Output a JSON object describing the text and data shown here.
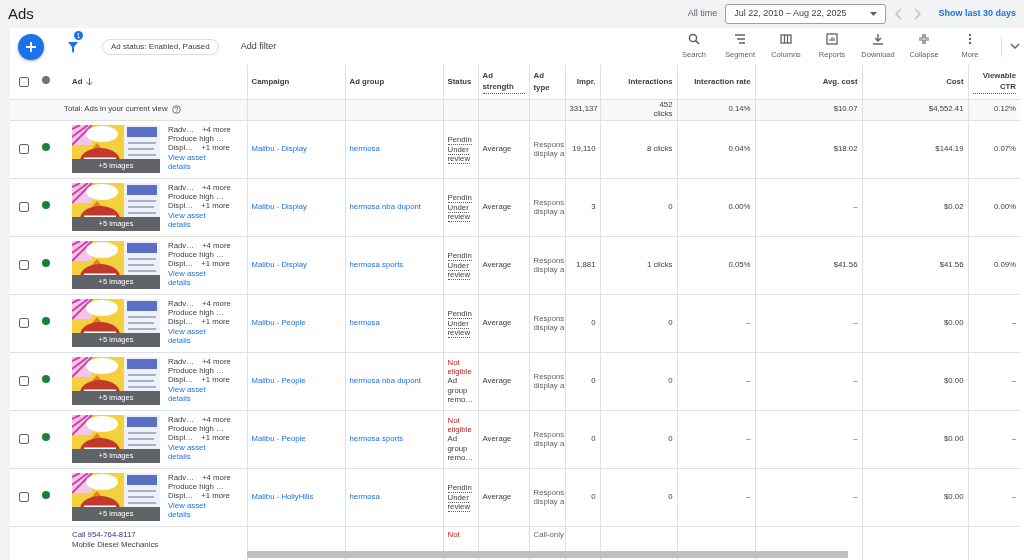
{
  "page_title": "Ads",
  "date_range": {
    "label": "All time",
    "value": "Jul 22, 2010 – Aug 22, 2025",
    "shortcut": "Show last 30 days"
  },
  "toolbar": {
    "filter_count": "1",
    "filter_chip": "Ad status: Enabled, Paused",
    "add_filter": "Add filter",
    "tools": [
      {
        "label": "Search"
      },
      {
        "label": "Segment"
      },
      {
        "label": "Columns"
      },
      {
        "label": "Reports"
      },
      {
        "label": "Download"
      },
      {
        "label": "Collapse"
      },
      {
        "label": "More"
      }
    ]
  },
  "table": {
    "select_all_checked": false,
    "columns": [
      {
        "label": "Ad",
        "sorted": true
      },
      {
        "label": "Campaign"
      },
      {
        "label": "Ad group"
      },
      {
        "label": "Status"
      },
      {
        "label": "Ad strength",
        "dotted": true
      },
      {
        "label": "Ad type"
      },
      {
        "label": "Impr.",
        "numeric": true
      },
      {
        "label": "Interactions",
        "numeric": true
      },
      {
        "label": "Interaction rate",
        "numeric": true
      },
      {
        "label": "Avg. cost",
        "numeric": true
      },
      {
        "label": "Cost",
        "numeric": true
      },
      {
        "label": "Viewable CTR",
        "numeric": true,
        "dotted": true
      }
    ],
    "total": {
      "label": "Total: Ads in your current view",
      "metrics": [
        "331,137",
        "452 clicks",
        "0.14%",
        "$10.07",
        "$4,552.41",
        "0.12%"
      ]
    },
    "rows": [
      {
        "kind": "display",
        "checked": false,
        "enabled": true,
        "images_more": "+5 images",
        "headline": "Radv…",
        "headline_more": "+4 more",
        "description": "Produce high …",
        "long_headline": "Displ…",
        "long_more": "+1 more",
        "details_link": "View asset details",
        "campaign": "Malibu - Display",
        "ad_group": "hermosa",
        "status": {
          "kind": "pending",
          "label": "Pendin",
          "detail": "Under review"
        },
        "ad_strength": "Average",
        "ad_type": [
          "Respons",
          "display a"
        ],
        "metrics": [
          "19,110",
          "8 clicks",
          "0.04%",
          "$18.02",
          "$144.19",
          "0.07%"
        ]
      },
      {
        "kind": "display",
        "checked": false,
        "enabled": true,
        "images_more": "+5 images",
        "headline": "Radv…",
        "headline_more": "+4 more",
        "description": "Produce high …",
        "long_headline": "Displ…",
        "long_more": "+1 more",
        "details_link": "View asset details",
        "campaign": "Malibu - Display",
        "ad_group": "hermosa nba dupont",
        "status": {
          "kind": "pending",
          "label": "Pendin",
          "detail": "Under review"
        },
        "ad_strength": "Average",
        "ad_type": [
          "Respons",
          "display a"
        ],
        "metrics": [
          "3",
          "0",
          "0.00%",
          "–",
          "$0.02",
          "0.00%"
        ]
      },
      {
        "kind": "display",
        "checked": false,
        "enabled": true,
        "images_more": "+5 images",
        "headline": "Radv…",
        "headline_more": "+4 more",
        "description": "Produce high …",
        "long_headline": "Displ…",
        "long_more": "+1 more",
        "details_link": "View asset details",
        "campaign": "Malibu - Display",
        "ad_group": "hermosa sports",
        "status": {
          "kind": "pending",
          "label": "Pendin",
          "detail": "Under review"
        },
        "ad_strength": "Average",
        "ad_type": [
          "Respons",
          "display a"
        ],
        "metrics": [
          "1,881",
          "1 clicks",
          "0.05%",
          "$41.56",
          "$41.56",
          "0.09%"
        ]
      },
      {
        "kind": "display",
        "checked": false,
        "enabled": true,
        "images_more": "+5 images",
        "headline": "Radv…",
        "headline_more": "+4 more",
        "description": "Produce high …",
        "long_headline": "Displ…",
        "long_more": "+1 more",
        "details_link": "View asset details",
        "campaign": "Malibu - People",
        "ad_group": "hermosa",
        "status": {
          "kind": "pending",
          "label": "Pendin",
          "detail": "Under review"
        },
        "ad_strength": "Average",
        "ad_type": [
          "Respons",
          "display a"
        ],
        "metrics": [
          "0",
          "0",
          "–",
          "–",
          "$0.00",
          "–"
        ]
      },
      {
        "kind": "display",
        "checked": false,
        "enabled": true,
        "images_more": "+5 images",
        "headline": "Radv…",
        "headline_more": "+4 more",
        "description": "Produce high …",
        "long_headline": "Displ…",
        "long_more": "+1 more",
        "details_link": "View asset details",
        "campaign": "Malibu - People",
        "ad_group": "hermosa nba dupont",
        "status": {
          "kind": "not_eligible",
          "label": "Not eligible",
          "detail": "Ad group remo…"
        },
        "ad_strength": "Average",
        "ad_type": [
          "Respons",
          "display a"
        ],
        "metrics": [
          "0",
          "0",
          "–",
          "–",
          "$0.00",
          "–"
        ]
      },
      {
        "kind": "display",
        "checked": false,
        "enabled": true,
        "images_more": "+5 images",
        "headline": "Radv…",
        "headline_more": "+4 more",
        "description": "Produce high …",
        "long_headline": "Displ…",
        "long_more": "+1 more",
        "details_link": "View asset details",
        "campaign": "Malibu - People",
        "ad_group": "hermosa sports",
        "status": {
          "kind": "not_eligible",
          "label": "Not eligible",
          "detail": "Ad group remo…"
        },
        "ad_strength": "Average",
        "ad_type": [
          "Respons",
          "display a"
        ],
        "metrics": [
          "0",
          "0",
          "–",
          "–",
          "$0.00",
          "–"
        ]
      },
      {
        "kind": "display",
        "checked": false,
        "enabled": true,
        "images_more": "+5 images",
        "headline": "Radv…",
        "headline_more": "+4 more",
        "description": "Produce high …",
        "long_headline": "Displ…",
        "long_more": "+1 more",
        "details_link": "View asset details",
        "campaign": "Malibu - HollyHills",
        "ad_group": "hermosa",
        "status": {
          "kind": "pending",
          "label": "Pendin",
          "detail": "Under review"
        },
        "ad_strength": "Average",
        "ad_type": [
          "Respons",
          "display a"
        ],
        "metrics": [
          "0",
          "0",
          "–",
          "–",
          "$0.00",
          "–"
        ]
      },
      {
        "kind": "call",
        "title": "Call 954-764-8117",
        "subtitle": "Mobile Diesel Mechanics",
        "status": {
          "kind": "not_eligible",
          "label": "Not"
        },
        "ad_type": [
          "Call-only"
        ]
      }
    ]
  }
}
